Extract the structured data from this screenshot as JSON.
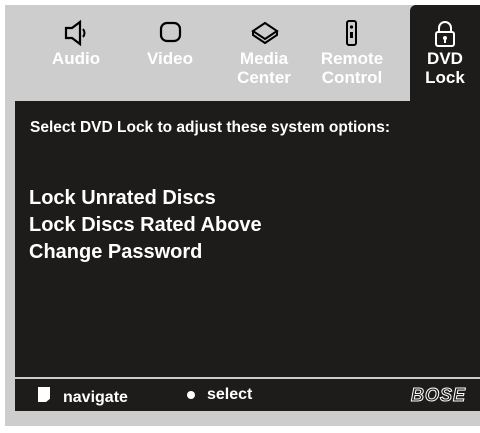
{
  "tabs": [
    {
      "label": "Audio",
      "icon": "speaker-icon"
    },
    {
      "label": "Video",
      "icon": "tv-icon"
    },
    {
      "label": "Media Center",
      "icon": "media-center-icon"
    },
    {
      "label": "Remote Control",
      "icon": "remote-icon"
    },
    {
      "label": "DVD Lock",
      "icon": "padlock-icon",
      "active": true
    }
  ],
  "panel": {
    "instruction": "Select DVD Lock to adjust these system options:",
    "menu": [
      "Lock Unrated Discs",
      "Lock Discs Rated Above",
      "Change Password"
    ]
  },
  "footer": {
    "navigate_label": "navigate",
    "select_label": "select",
    "brand": "BOSE",
    "navigate_icon": "navigation-pad-icon",
    "select_icon": "select-dot-icon"
  },
  "colors": {
    "panel": "#1e1b1b",
    "frame": "#cdcdcd",
    "text": "#ffffff"
  }
}
